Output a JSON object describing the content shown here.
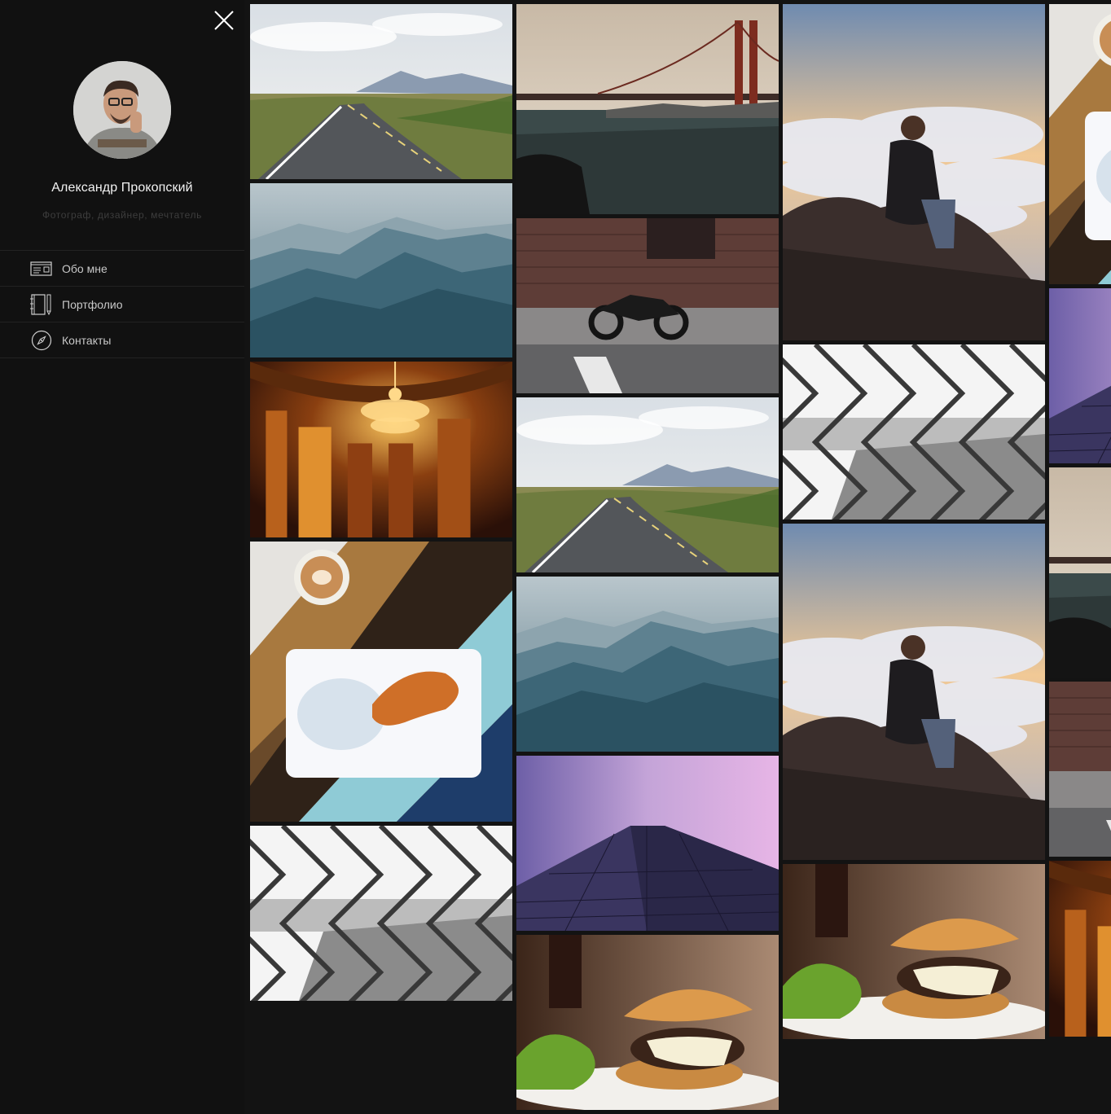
{
  "profile": {
    "name": "Александр Прокопский",
    "tagline": "Фотограф, дизайнер, мечтатель",
    "avatar_icon": "avatar-photo"
  },
  "nav": {
    "items": [
      {
        "label": "Обо мне",
        "icon": "id-card-icon"
      },
      {
        "label": "Портфолио",
        "icon": "notebook-icon"
      },
      {
        "label": "Контакты",
        "icon": "compass-icon"
      }
    ]
  },
  "close_icon": "close-icon",
  "gallery": {
    "photos": [
      {
        "subject": "road"
      },
      {
        "subject": "misty-mountains"
      },
      {
        "subject": "chandelier-theater"
      },
      {
        "subject": "food-plate"
      },
      {
        "subject": "chain-fence"
      },
      {
        "subject": "golden-gate-bridge"
      },
      {
        "subject": "motorcycle"
      },
      {
        "subject": "road"
      },
      {
        "subject": "misty-mountains"
      },
      {
        "subject": "skyscraper"
      },
      {
        "subject": "burger"
      },
      {
        "subject": "man-above-clouds"
      },
      {
        "subject": "chain-fence"
      },
      {
        "subject": "man-above-clouds"
      },
      {
        "subject": "burger"
      },
      {
        "subject": "food-plate"
      },
      {
        "subject": "skyscraper"
      },
      {
        "subject": "golden-gate-bridge"
      },
      {
        "subject": "motorcycle"
      },
      {
        "subject": "chandelier-theater"
      }
    ]
  }
}
